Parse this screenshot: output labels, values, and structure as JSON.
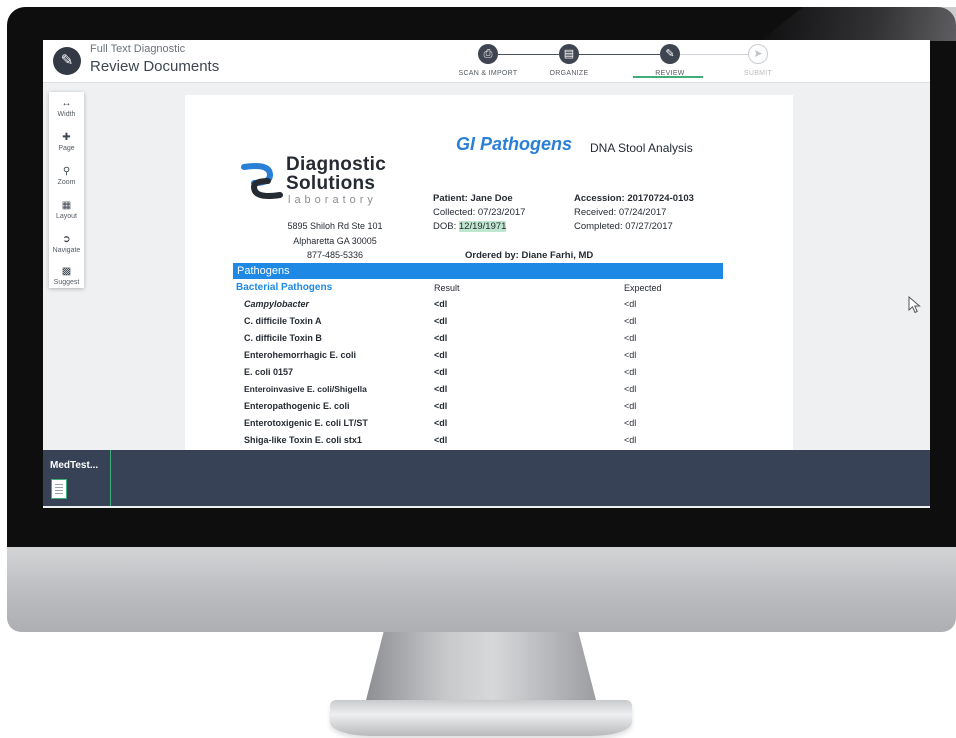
{
  "app": {
    "subtitle": "Full Text Diagnostic",
    "title": "Review Documents",
    "steps": [
      {
        "label": "SCAN & IMPORT",
        "icon": "printer-icon",
        "state": "done"
      },
      {
        "label": "ORGANIZE",
        "icon": "document-icon",
        "state": "done"
      },
      {
        "label": "REVIEW",
        "icon": "pencil-icon",
        "state": "active"
      },
      {
        "label": "SUBMIT",
        "icon": "send-icon",
        "state": "inactive"
      }
    ],
    "colors": {
      "accent": "#3fae7a",
      "header_blue": "#1e88e5",
      "title_blue": "#2a7fd6",
      "tray": "#384257"
    }
  },
  "toolbox": {
    "tools": [
      {
        "label": "Width",
        "icon": "width-icon"
      },
      {
        "label": "Page",
        "icon": "page-icon"
      },
      {
        "label": "Zoom",
        "icon": "zoom-icon"
      },
      {
        "label": "Layout",
        "icon": "layout-icon"
      },
      {
        "label": "Navigate",
        "icon": "navigate-icon"
      },
      {
        "label": "Suggest",
        "icon": "suggest-icon"
      }
    ]
  },
  "document": {
    "logo": {
      "line1": "Diagnostic",
      "line2": "Solutions",
      "line3": "laboratory"
    },
    "address": {
      "street": "5895 Shiloh Rd Ste 101",
      "city": "Alpharetta GA 30005",
      "phone": "877-485-5336"
    },
    "title": "GI Pathogens",
    "subtitle": "DNA Stool Analysis",
    "patient": "Patient:  Jane Doe",
    "collected": "Collected: 07/23/2017",
    "dob_label": "DOB: ",
    "dob_value": "12/19/1971",
    "accession": "Accession: 20170724-0103",
    "received": "Received: 07/24/2017",
    "completed": "Completed: 07/27/2017",
    "ordered_by": "Ordered by: Diane Farhi, MD",
    "section": "Pathogens",
    "subsection": "Bacterial Pathogens",
    "col_result": "Result",
    "col_expected": "Expected",
    "rows": [
      {
        "name": "Campylobacter",
        "result": "<dl",
        "expected": "<dl"
      },
      {
        "name": "C. difficile  Toxin A",
        "result": "<dl",
        "expected": "<dl"
      },
      {
        "name": "C. difficile  Toxin B",
        "result": "<dl",
        "expected": "<dl"
      },
      {
        "name": "Enterohemorrhagic E. coli",
        "result": "<dl",
        "expected": "<dl"
      },
      {
        "name": "E. coli  0157",
        "result": "<dl",
        "expected": "<dl"
      },
      {
        "name": "Enteroinvasive E. coli/Shigella",
        "result": "<dl",
        "expected": "<dl"
      },
      {
        "name": "Enteropathogenic E. coli",
        "result": "<dl",
        "expected": "<dl"
      },
      {
        "name": "Enterotoxigenic E. coli  LT/ST",
        "result": "<dl",
        "expected": "<dl"
      },
      {
        "name": "Shiga-like Toxin E. coli  stx1",
        "result": "<dl",
        "expected": "<dl"
      }
    ]
  },
  "tray": {
    "item_label": "MedTest..."
  }
}
